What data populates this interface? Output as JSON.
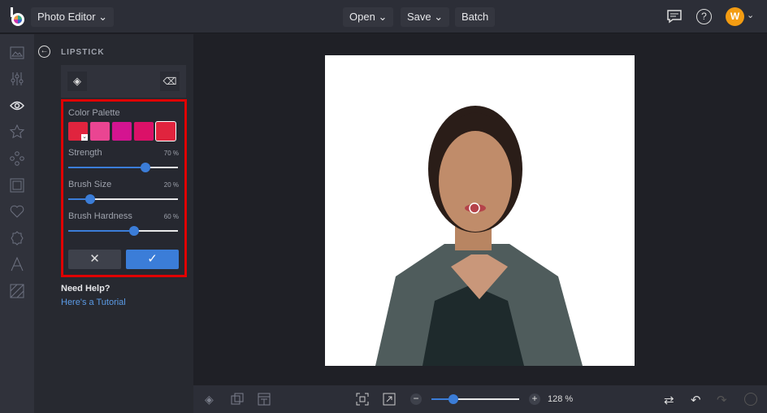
{
  "topbar": {
    "app_title": "Photo Editor",
    "open": "Open",
    "save": "Save",
    "batch": "Batch",
    "avatar_initial": "W"
  },
  "panel": {
    "title": "LIPSTICK",
    "color_palette_label": "Color Palette",
    "swatches": [
      "#e0243e",
      "#ea4592",
      "#d41490",
      "#db1168",
      "#e0243e"
    ],
    "sliders": [
      {
        "label": "Strength",
        "value": "70 %",
        "fraction": 0.7
      },
      {
        "label": "Brush Size",
        "value": "20 %",
        "fraction": 0.2
      },
      {
        "label": "Brush Hardness",
        "value": "60 %",
        "fraction": 0.6
      }
    ],
    "need_help": "Need Help?",
    "tutorial_link": "Here's a Tutorial"
  },
  "bottombar": {
    "zoom_value": "128 %",
    "zoom_fraction": 0.25
  },
  "colors": {
    "accent": "#3b7dd8",
    "highlight": "#e00000"
  }
}
